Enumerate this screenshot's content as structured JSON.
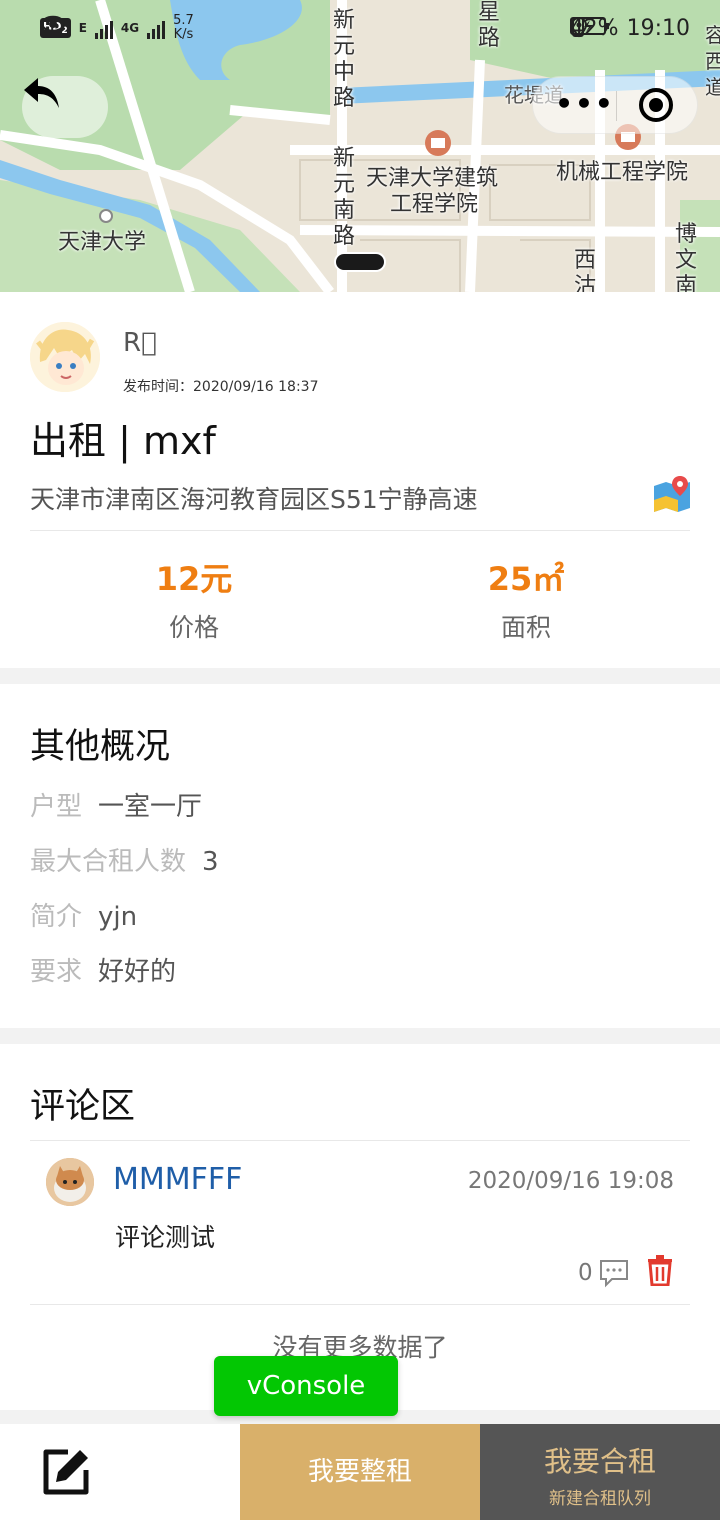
{
  "status_bar": {
    "network_badge": "HD",
    "network_badge_sub": "2",
    "network_type_1": "E",
    "network_type_2": "4G",
    "speed_value": "5.7",
    "speed_unit": "K/s",
    "battery": "42%",
    "time": "19:10"
  },
  "map": {
    "labels": {
      "tianjin_univ": "天津大学",
      "architecture": "天津大学建筑",
      "architecture_2": "工程学院",
      "mechanical": "机械工程学院",
      "huadi_road": "花堤道",
      "xinyuan_zhong_1": "新",
      "xinyuan_zhong_2": "元",
      "xinyuan_zhong_3": "中",
      "xinyuan_zhong_4": "路",
      "xinyuan_nan_1": "新",
      "xinyuan_nan_2": "元",
      "xinyuan_nan_3": "南",
      "xinyuan_nan_4": "路",
      "xi_1": "西",
      "xi_2": "沽",
      "bowen_1": "博",
      "bowen_2": "文",
      "bowen_3": "南",
      "rongyuan_1": "容",
      "rongyuan_2": "西",
      "rongyuan_3": "道",
      "xingyuan_1": "星",
      "xingyuan_2": "路"
    },
    "menu_dots": "•••"
  },
  "post": {
    "username": "R\u0000",
    "publish_time": "发布时间：2020/09/16 18:37",
    "title": "出租 | mxf",
    "address": "天津市津南区海河教育园区S51宁静高速",
    "price": {
      "value": "12元",
      "label": "价格"
    },
    "area": {
      "value": "25㎡",
      "label": "面积"
    }
  },
  "overview": {
    "title": "其他概况",
    "items": [
      {
        "key": "户型",
        "value": "一室一厅"
      },
      {
        "key": "最大合租人数",
        "value": "3"
      },
      {
        "key": "简介",
        "value": "yjn"
      },
      {
        "key": "要求",
        "value": "好好的"
      }
    ]
  },
  "comments": {
    "title": "评论区",
    "items": [
      {
        "name": "MMMFFF",
        "time": "2020/09/16 19:08",
        "text": "评论测试",
        "reply_count": "0"
      }
    ],
    "no_more": "没有更多数据了"
  },
  "vconsole": "vConsole",
  "bottom_bar": {
    "whole_rent": "我要整租",
    "share_rent": "我要合租",
    "share_rent_sub": "新建合租队列"
  },
  "colors": {
    "accent_orange": "#ef7e12",
    "gold": "#d9b06a",
    "dark_button": "#555555",
    "vconsole_green": "#03c703",
    "comment_name": "#1f5ea8"
  }
}
